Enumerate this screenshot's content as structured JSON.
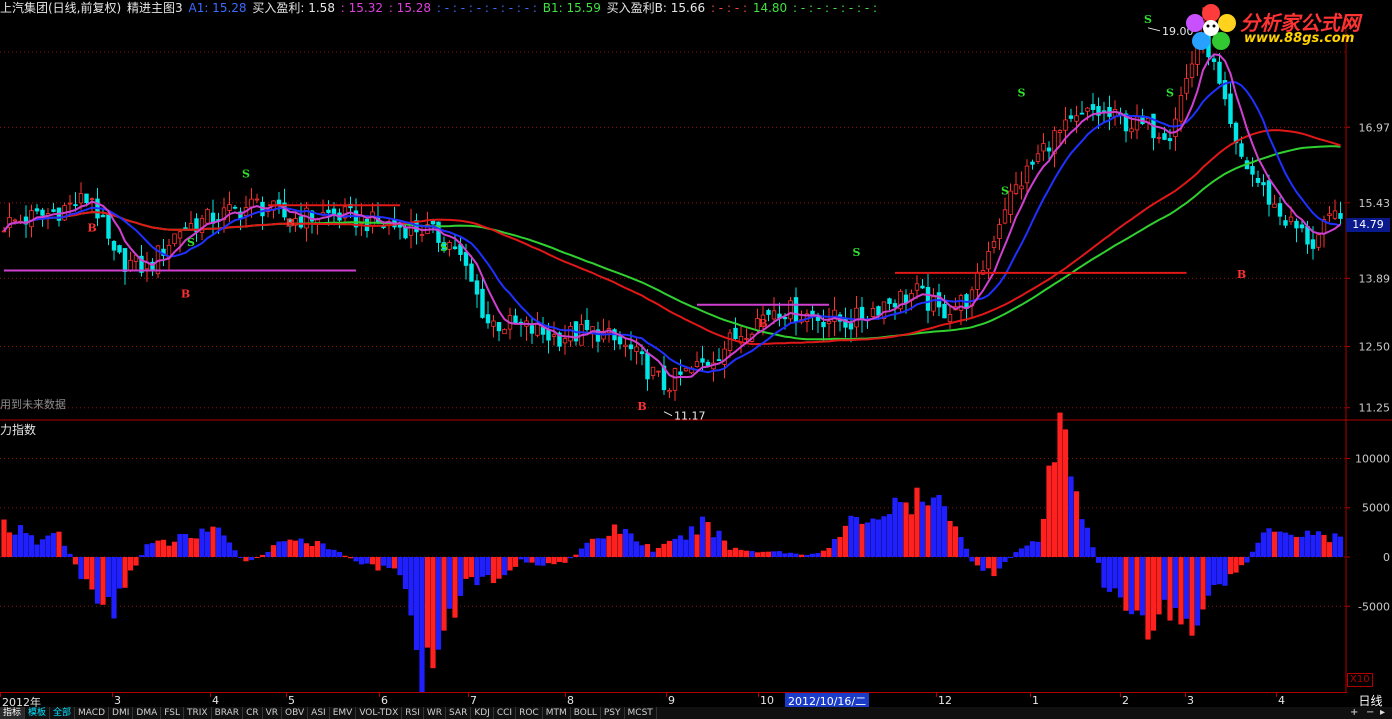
{
  "header": {
    "stock": "上汽集团(日线,前复权)",
    "indicator": "精进主图3",
    "a1_label": "A1: 15.28",
    "buy_profit_label": "买入盈利: 1.58",
    "v1": ": 15.32",
    "v2": ": 15.28",
    "dashes1": ": - : - : - : - : - : - :",
    "b1_label": "B1: 15.59",
    "buy_profit_b_label": "买入盈利B: 15.66",
    "dashes2": ": - : - :",
    "v3": "14.80",
    "dashes3": ": - : - : - : - : - :"
  },
  "colors": {
    "up": "#ff3232",
    "down": "#00e6e6",
    "ma_short": "#d040d0",
    "ma_mid": "#2030ff",
    "ma_green": "#30d030",
    "ma_red": "#e01818",
    "grid": "#8c1010",
    "bar_up": "#ff2020",
    "bar_down": "#2020ff"
  },
  "logo": {
    "name": "分析家公式网",
    "url": "www.88gs.com"
  },
  "main_panel": {
    "warning": "用到未来数据"
  },
  "sub_panel": {
    "title": "力指数"
  },
  "current_price": "14.79",
  "zoom": "X10",
  "period": "日线",
  "x_axis": {
    "labels": [
      "2012年",
      "3",
      "4",
      "5",
      "6",
      "7",
      "8",
      "9",
      "10",
      "12",
      "1",
      "2",
      "3",
      "4"
    ],
    "selected": "2012/10/16/二"
  },
  "tabs": [
    "指标",
    "模板",
    "全部",
    "MACD",
    "DMI",
    "DMA",
    "FSL",
    "TRIX",
    "BRAR",
    "CR",
    "VR",
    "OBV",
    "ASI",
    "EMV",
    "VOL-TDX",
    "RSI",
    "WR",
    "SAR",
    "KDJ",
    "CCI",
    "ROC",
    "MTM",
    "BOLL",
    "PSY",
    "MCST"
  ],
  "chart_data": [
    {
      "type": "candlestick",
      "title": "上汽集团(日线,前复权)",
      "y_ticks": [
        11.25,
        12.5,
        13.89,
        15.43,
        16.97
      ],
      "ylim": [
        11.0,
        19.2
      ],
      "annotations": {
        "high": "19.00",
        "low": "11.17"
      },
      "signal_labels": [
        "S",
        "B"
      ],
      "series_close_anchors": {
        "x": [
          0,
          8,
          16,
          20,
          26,
          32,
          40,
          46,
          52,
          60,
          68,
          76,
          82,
          88,
          94,
          100,
          108,
          114,
          120,
          128,
          134,
          140,
          148,
          154,
          160,
          166,
          170,
          176,
          182,
          190,
          198,
          206,
          212,
          218,
          224,
          232,
          238,
          243
        ],
        "close": [
          15.0,
          15.2,
          15.55,
          14.3,
          14.1,
          14.9,
          15.2,
          15.4,
          15.1,
          15.2,
          15.0,
          14.9,
          14.55,
          13.0,
          12.9,
          12.7,
          12.8,
          12.4,
          11.7,
          12.2,
          12.8,
          13.3,
          13.1,
          13.0,
          13.4,
          13.6,
          13.2,
          13.5,
          15.4,
          16.7,
          17.3,
          17.0,
          16.9,
          19.0,
          16.5,
          15.2,
          14.6,
          15.3
        ]
      }
    },
    {
      "type": "bar",
      "title": "力指数",
      "y_ticks": [
        -5000,
        0,
        5000,
        10000
      ],
      "ylim": [
        -13500,
        13500
      ],
      "series_anchors": {
        "x": [
          0,
          6,
          10,
          15,
          20,
          26,
          30,
          38,
          44,
          48,
          52,
          60,
          66,
          72,
          76,
          80,
          84,
          88,
          92,
          94,
          98,
          102,
          108,
          112,
          118,
          122,
          128,
          132,
          136,
          140,
          146,
          150,
          154,
          160,
          166,
          172,
          176,
          180,
          184,
          188,
          192,
          196,
          200,
          204,
          208,
          212,
          216,
          220,
          222,
          224,
          226,
          230,
          234,
          238,
          240,
          243
        ],
        "value": [
          3500,
          1500,
          2500,
          -3000,
          -5000,
          1200,
          1500,
          3000,
          -600,
          600,
          2200,
          700,
          -900,
          -1500,
          -12500,
          -7500,
          -3000,
          -2500,
          -1500,
          -300,
          -900,
          -600,
          2000,
          3000,
          700,
          1500,
          3500,
          900,
          600,
          600,
          200,
          900,
          3500,
          4500,
          5500,
          5000,
          -400,
          -2000,
          600,
          1500,
          13000,
          5000,
          -2500,
          -4500,
          -8000,
          -5500,
          -7000,
          -4000,
          -2500,
          -1500,
          -500,
          3500,
          2500,
          2500,
          2200,
          1800
        ]
      }
    }
  ]
}
